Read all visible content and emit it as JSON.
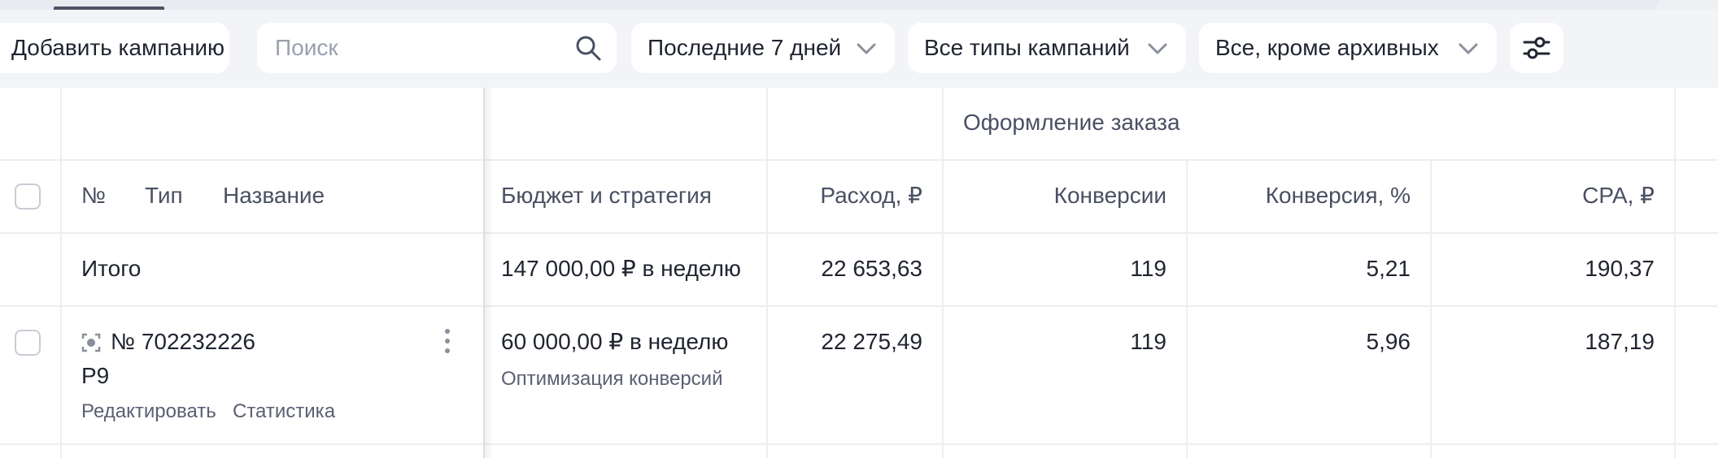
{
  "toolbar": {
    "add_campaign_label": "Добавить кампанию",
    "search_placeholder": "Поиск",
    "period_label": "Последние 7 дней",
    "campaign_type_label": "Все типы кампаний",
    "status_filter_label": "Все, кроме архивных",
    "settings_icon": "sliders-icon"
  },
  "table": {
    "group_header": "Оформление заказа",
    "columns": {
      "number": "№",
      "type": "Тип",
      "name": "Название",
      "budget": "Бюджет и стратегия",
      "spend": "Расход, ₽",
      "conversions": "Конверсии",
      "conversion_rate": "Конверсия, %",
      "cpa": "CPA, ₽"
    },
    "totals": {
      "label": "Итого",
      "budget": "147 000,00 ₽ в неделю",
      "spend": "22 653,63",
      "conversions": "119",
      "conversion_rate": "5,21",
      "cpa": "190,37"
    },
    "rows": [
      {
        "number": "№ 702232226",
        "name": "Р9",
        "edit_link": "Редактировать",
        "stats_link": "Статистика",
        "budget": "60 000,00 ₽ в неделю",
        "strategy": "Оптимизация конверсий",
        "spend": "22 275,49",
        "conversions": "119",
        "conversion_rate": "5,96",
        "cpa": "187,19"
      }
    ]
  },
  "colors": {
    "background": "#f3f4f7",
    "panel": "#ffffff",
    "text": "#1f2430",
    "muted": "#5a6073"
  }
}
